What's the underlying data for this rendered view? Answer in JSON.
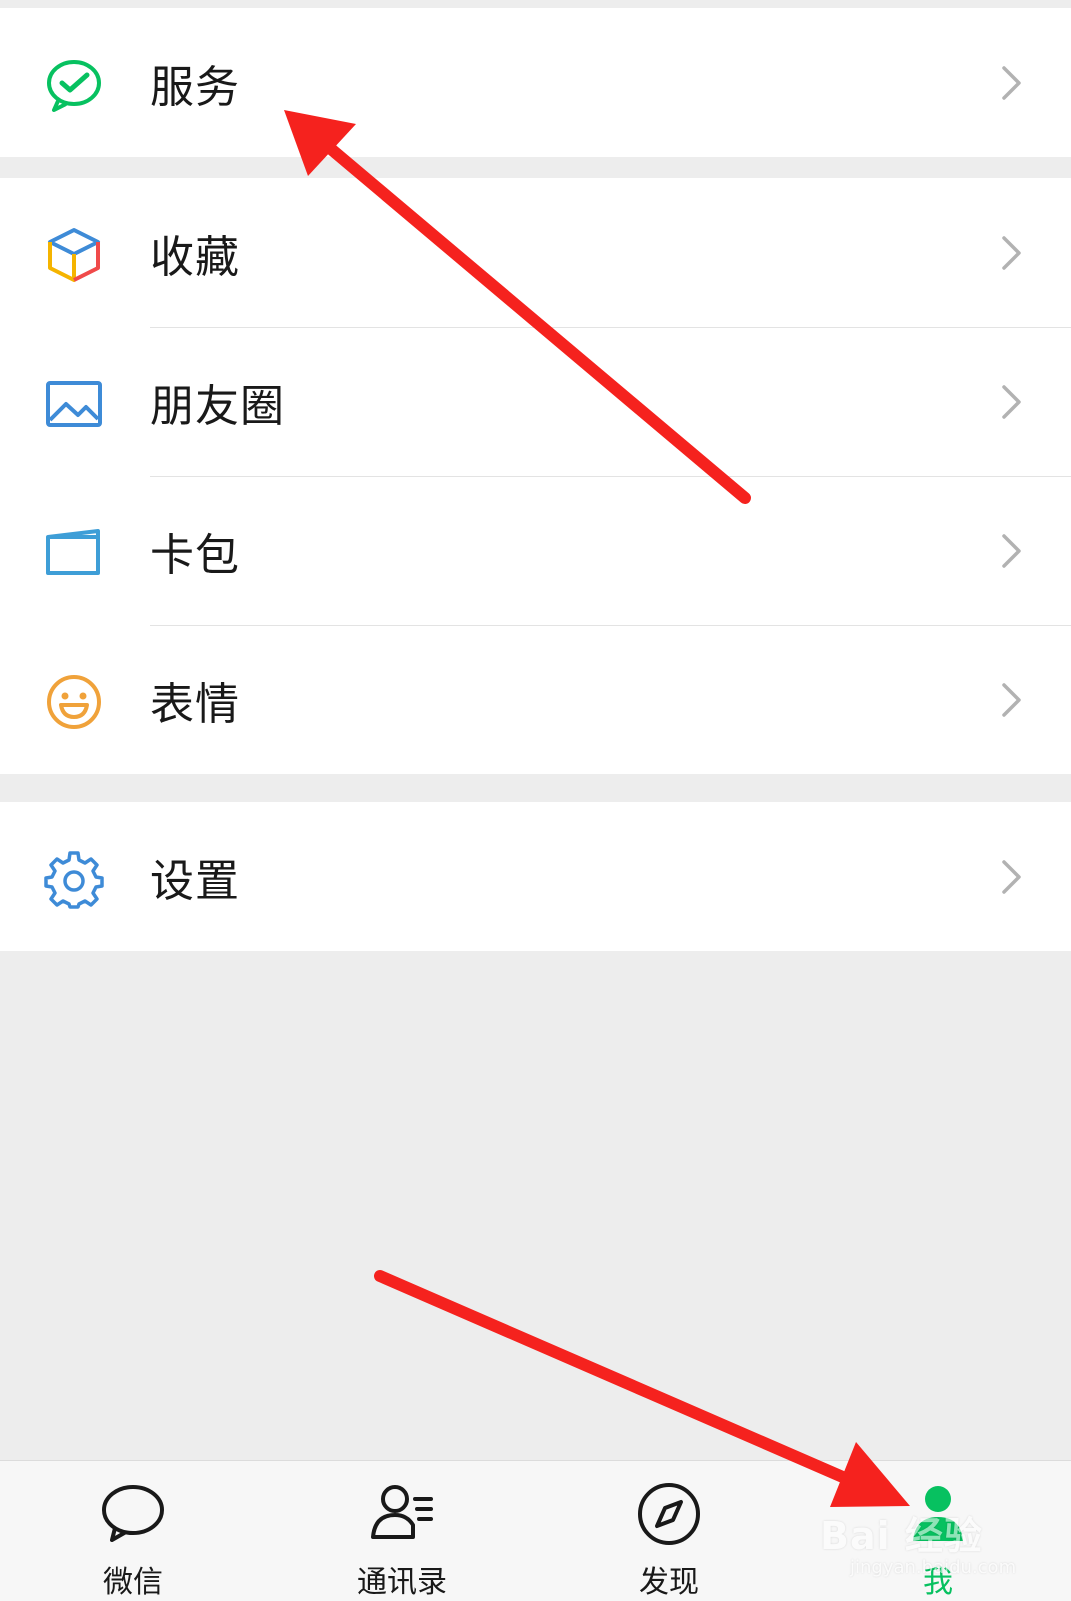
{
  "menu": {
    "group1": [
      {
        "label": "服务",
        "icon": "services-icon"
      }
    ],
    "group2": [
      {
        "label": "收藏",
        "icon": "favorites-cube-icon"
      },
      {
        "label": "朋友圈",
        "icon": "moments-image-icon"
      },
      {
        "label": "卡包",
        "icon": "card-wallet-icon"
      },
      {
        "label": "表情",
        "icon": "sticker-smile-icon"
      }
    ],
    "group3": [
      {
        "label": "设置",
        "icon": "settings-gear-icon"
      }
    ]
  },
  "tabbar": {
    "tabs": [
      {
        "label": "微信",
        "icon": "chat-bubble-icon",
        "active": false
      },
      {
        "label": "通讯录",
        "icon": "contacts-icon",
        "active": false
      },
      {
        "label": "发现",
        "icon": "compass-icon",
        "active": false
      },
      {
        "label": "我",
        "icon": "me-person-icon",
        "active": true
      }
    ]
  },
  "watermark": {
    "main": "Bai 经验",
    "sub": "jingyan.baidu.com"
  },
  "colors": {
    "accent_green": "#07c160",
    "annotation_red": "#f5221e",
    "background": "#ededed"
  }
}
